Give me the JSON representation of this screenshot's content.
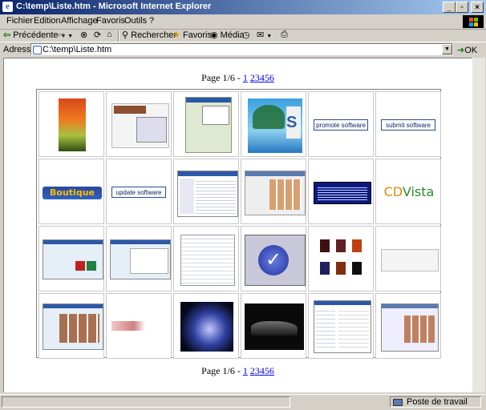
{
  "window": {
    "title": "C:\\temp\\Liste.htm - Microsoft Internet Explorer"
  },
  "menu": [
    "Fichier",
    "Edition",
    "Affichage",
    "Favoris",
    "Outils",
    "?"
  ],
  "toolbar": {
    "back": "Précédente",
    "search": "Rechercher",
    "favorites": "Favoris",
    "media": "Média"
  },
  "address": {
    "label": "Adresse",
    "value": "C:\\temp\\Liste.htm",
    "go": "OK"
  },
  "pager": {
    "prefix": "Page 1/6 -",
    "pages": [
      "1",
      "2",
      "3",
      "4",
      "5",
      "6"
    ]
  },
  "thumbs": {
    "promote": "promote software",
    "submit": "submit software",
    "update": "update software",
    "boutique": "Boutique",
    "cdvista_cd": "CD",
    "cdvista_vista": "Vista"
  },
  "status": {
    "zone": "Poste de travail"
  },
  "colors": {
    "title_start": "#0a246a",
    "title_end": "#a6caf0",
    "link": "#0000ee"
  }
}
